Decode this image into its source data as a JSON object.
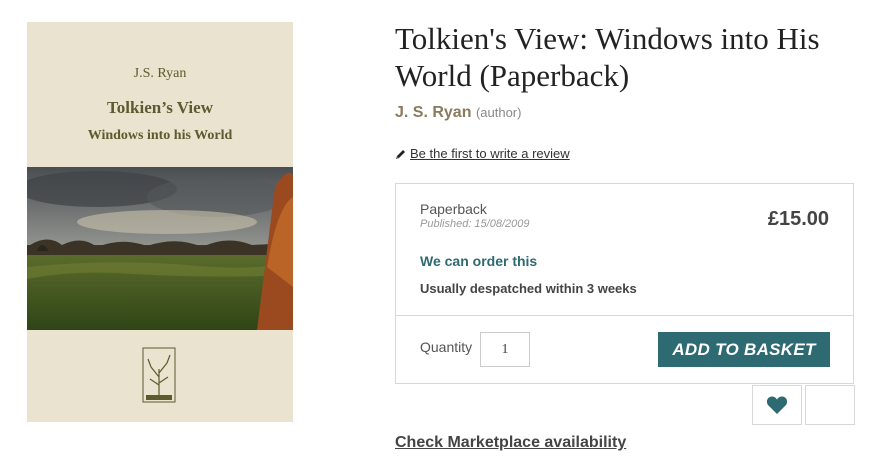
{
  "cover": {
    "author": "J.S. Ryan",
    "title": "Tolkien’s View",
    "subtitle": "Windows into his World"
  },
  "product": {
    "title": "Tolkien's View: Windows into His World (Paperback)",
    "author_name": "J. S. Ryan",
    "author_role": "(author)",
    "review_link": "Be the first to write a review"
  },
  "purchase": {
    "format": "Paperback",
    "published": "Published: 15/08/2009",
    "price": "£15.00",
    "availability": "We can order this",
    "dispatch": "Usually despatched within 3 weeks",
    "quantity_label": "Quantity",
    "quantity_value": "1",
    "add_button": "ADD TO BASKET"
  },
  "marketplace_link": "Check Marketplace availability",
  "icons": {
    "review": "pencil-icon",
    "wishlist": "heart-icon"
  },
  "colors": {
    "accent": "#2e6a72",
    "author": "#8a7a5e",
    "cover_background": "#e9e3cf",
    "cover_text": "#5c5a2e"
  }
}
